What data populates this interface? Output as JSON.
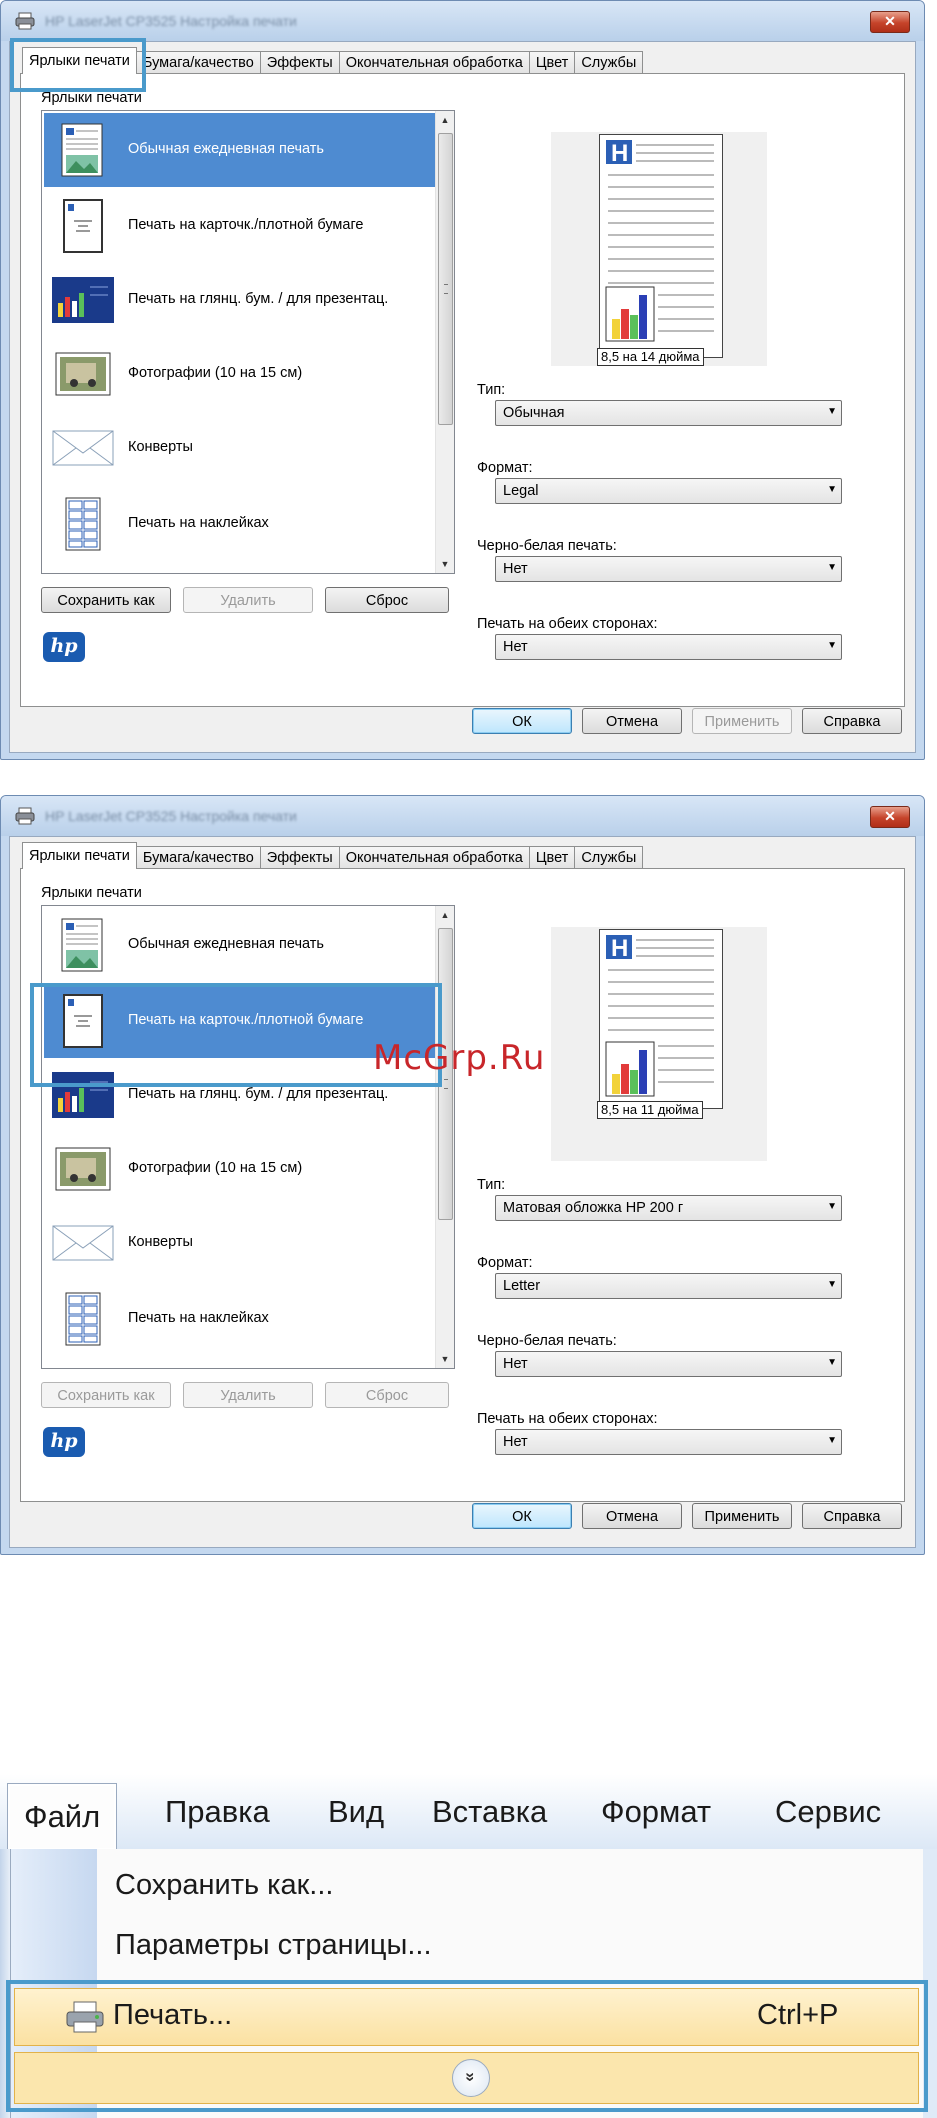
{
  "dialog1": {
    "title": "HP LaserJet CP3525 Настройка печати",
    "close": "✕",
    "tabs": [
      "Ярлыки печати",
      "Бумага/качество",
      "Эффекты",
      "Окончательная обработка",
      "Цвет",
      "Службы"
    ],
    "group_label": "Ярлыки печати",
    "items": [
      "Обычная ежедневная печать",
      "Печать на карточк./плотной бумаге",
      "Печать на глянц. бум. / для презентац.",
      "Фотографии (10 на 15 см)",
      "Конверты",
      "Печать на наклейках"
    ],
    "buttons": {
      "save_as": "Сохранить как",
      "delete": "Удалить",
      "reset": "Сброс"
    },
    "preview_size": "8,5 на 14 дюйма",
    "fields": {
      "type_label": "Тип:",
      "type_value": "Обычная",
      "format_label": "Формат:",
      "format_value": "Legal",
      "bw_label": "Черно-белая печать:",
      "bw_value": "Нет",
      "duplex_label": "Печать на обеих сторонах:",
      "duplex_value": "Нет"
    },
    "footer": {
      "ok": "ОК",
      "cancel": "Отмена",
      "apply": "Применить",
      "help": "Справка"
    },
    "logo": "hp"
  },
  "dialog2": {
    "title": "HP LaserJet CP3525 Настройка печати",
    "close": "✕",
    "tabs": [
      "Ярлыки печати",
      "Бумага/качество",
      "Эффекты",
      "Окончательная обработка",
      "Цвет",
      "Службы"
    ],
    "group_label": "Ярлыки печати",
    "items": [
      "Обычная ежедневная печать",
      "Печать на карточк./плотной бумаге",
      "Печать на глянц. бум. / для презентац.",
      "Фотографии (10 на 15 см)",
      "Конверты",
      "Печать на наклейках"
    ],
    "buttons": {
      "save_as": "Сохранить как",
      "delete": "Удалить",
      "reset": "Сброс"
    },
    "preview_size": "8,5 на 11 дюйма",
    "fields": {
      "type_label": "Тип:",
      "type_value": "Матовая обложка HP 200 г",
      "format_label": "Формат:",
      "format_value": "Letter",
      "bw_label": "Черно-белая печать:",
      "bw_value": "Нет",
      "duplex_label": "Печать на обеих сторонах:",
      "duplex_value": "Нет"
    },
    "footer": {
      "ok": "ОК",
      "cancel": "Отмена",
      "apply": "Применить",
      "help": "Справка"
    },
    "logo": "hp"
  },
  "watermark": "McGrp.Ru",
  "menu": {
    "bar": [
      "Файл",
      "Правка",
      "Вид",
      "Вставка",
      "Формат",
      "Сервис"
    ],
    "items": {
      "save_as": "Сохранить как...",
      "page_setup": "Параметры страницы...",
      "print": "Печать...",
      "print_shortcut": "Ctrl+P"
    },
    "expand": "»"
  },
  "colors": {
    "selection": "#4e8bd1",
    "highlight": "#4a9acb",
    "menu_hover": "#fbe1a2",
    "watermark": "#c8262a"
  }
}
